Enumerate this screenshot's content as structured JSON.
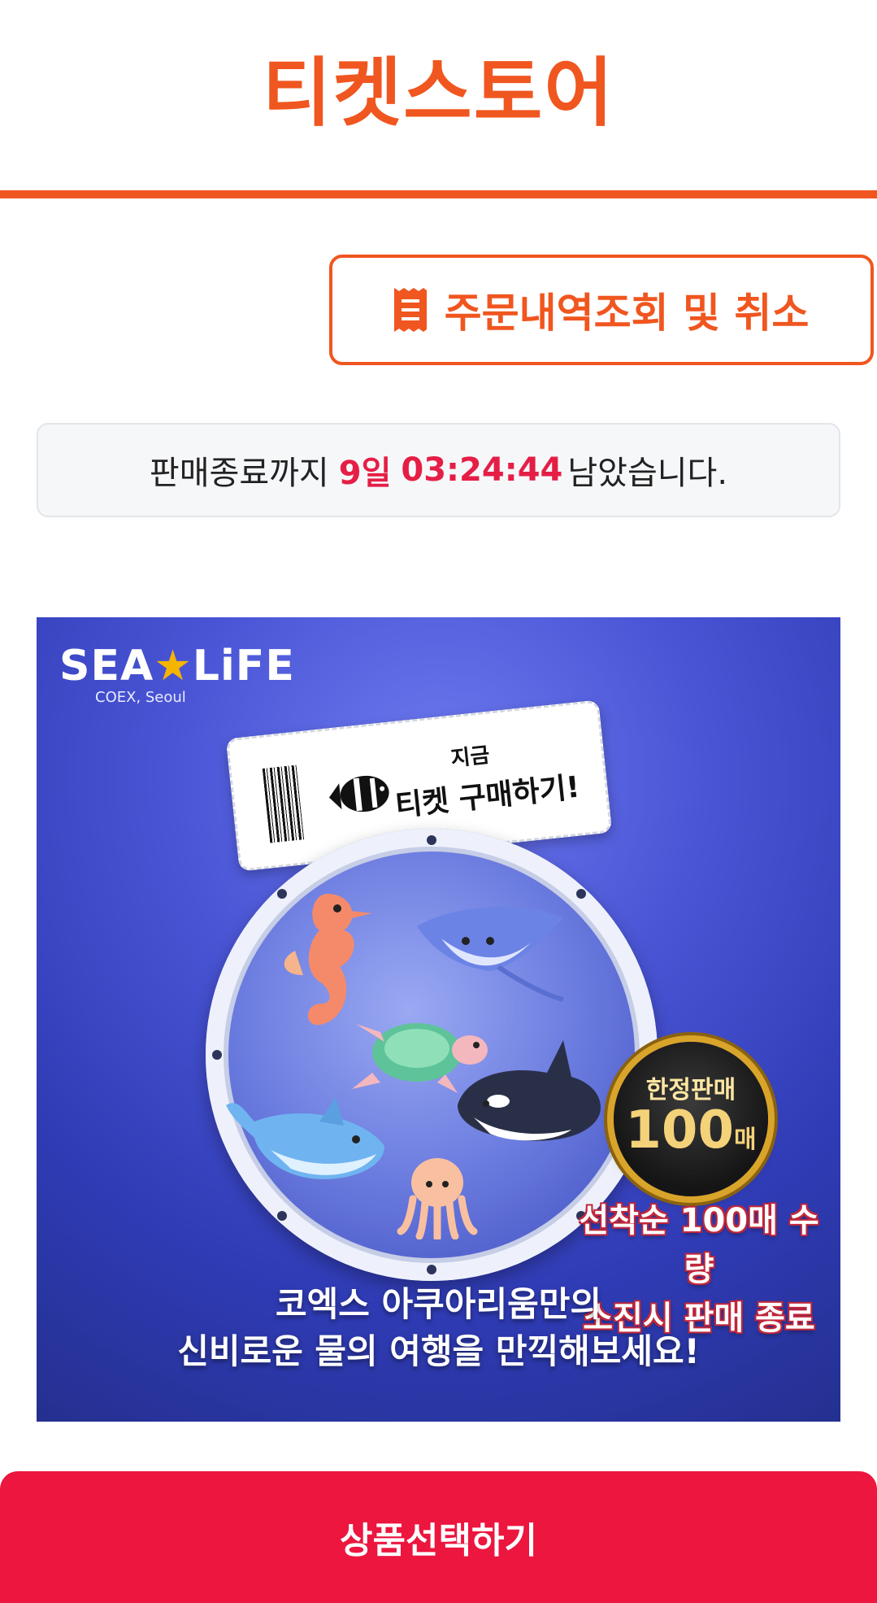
{
  "header": {
    "title": "티켓스토어",
    "accent_color": "#f0561f"
  },
  "order_button": {
    "label": "주문내역조회 및 취소",
    "icon": "receipt-icon"
  },
  "countdown": {
    "prefix": "판매종료까지",
    "days": "9일",
    "time": "03:24:44",
    "suffix": "남았습니다.",
    "highlight_color": "#e51e46"
  },
  "banner": {
    "logo": {
      "left": "SEA",
      "right": "LiFE",
      "sub": "COEX, Seoul"
    },
    "ticket": {
      "line1": "지금",
      "line2": "티켓 구매하기!"
    },
    "badge": {
      "top": "한정판매",
      "number": "100",
      "unit": "매"
    },
    "notice": {
      "line1": "선착순 100매 수량",
      "line2": "소진시 판매 종료"
    },
    "tagline": {
      "line1": "코엑스 아쿠아리움만의",
      "line2": "신비로운 물의 여행을 만끽해보세요!"
    }
  },
  "cta": {
    "label": "상품선택하기",
    "color": "#ec163f"
  }
}
